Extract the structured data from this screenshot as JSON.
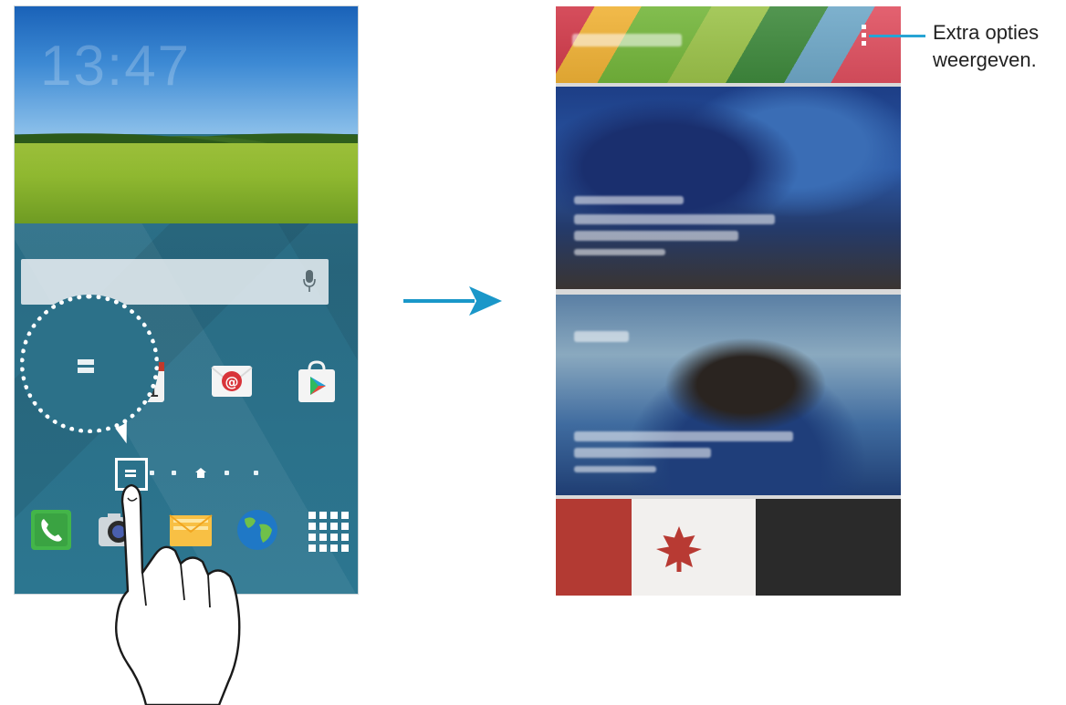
{
  "left_screen": {
    "clock": "13:47",
    "search": {
      "placeholder": ""
    },
    "apps_row1": [
      {
        "name": "calendar",
        "icon": "calendar-icon",
        "date": "31"
      },
      {
        "name": "email",
        "icon": "email-icon",
        "symbol": "@"
      },
      {
        "name": "play-store",
        "icon": "play-store-icon"
      }
    ],
    "dock": [
      {
        "name": "phone",
        "icon": "phone-icon"
      },
      {
        "name": "camera",
        "icon": "camera-icon"
      },
      {
        "name": "messages",
        "icon": "messages-icon"
      },
      {
        "name": "internet",
        "icon": "globe-icon"
      },
      {
        "name": "apps",
        "icon": "apps-grid-icon"
      }
    ],
    "page_indicator": {
      "pages": 6,
      "active": "home"
    }
  },
  "right_screen": {
    "menu_icon": "more-options-icon"
  },
  "callout": {
    "line1": "Extra opties",
    "line2": "weergeven."
  },
  "colors": {
    "accent": "#27a4d4",
    "arrow": "#1a97c9",
    "dock_bg": "#2d7189"
  }
}
